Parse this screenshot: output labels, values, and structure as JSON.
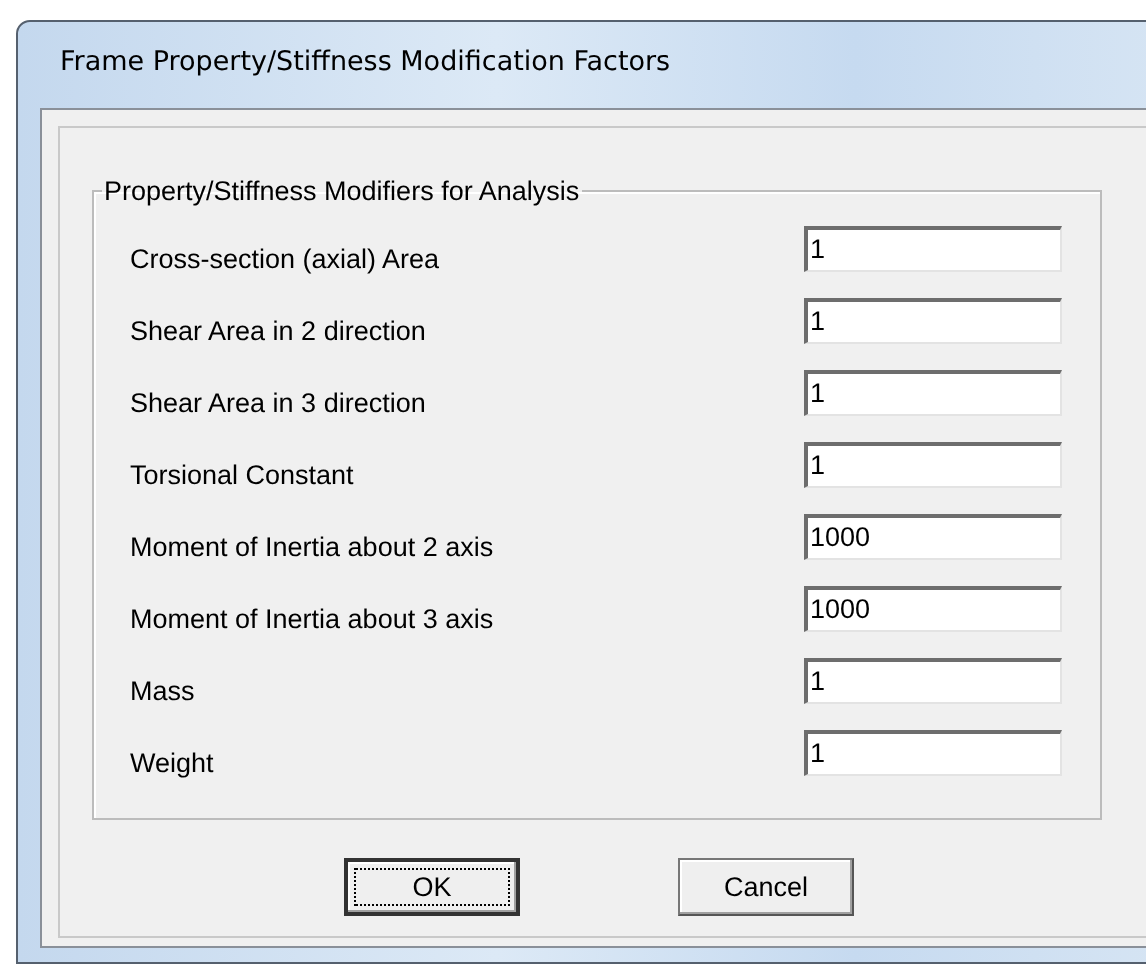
{
  "window": {
    "title": "Frame Property/Stiffness Modification Factors"
  },
  "group": {
    "title": "Property/Stiffness Modifiers for Analysis",
    "fields": [
      {
        "label": "Cross-section (axial) Area",
        "value": "1"
      },
      {
        "label": "Shear Area in 2 direction",
        "value": "1"
      },
      {
        "label": "Shear Area in 3 direction",
        "value": "1"
      },
      {
        "label": "Torsional Constant",
        "value": "1"
      },
      {
        "label": "Moment of Inertia about 2 axis",
        "value": "1000"
      },
      {
        "label": "Moment of Inertia about 3 axis",
        "value": "1000"
      },
      {
        "label": "Mass",
        "value": "1"
      },
      {
        "label": "Weight",
        "value": "1"
      }
    ]
  },
  "buttons": [
    {
      "label": "OK",
      "default": true
    },
    {
      "label": "Cancel",
      "default": false
    }
  ]
}
